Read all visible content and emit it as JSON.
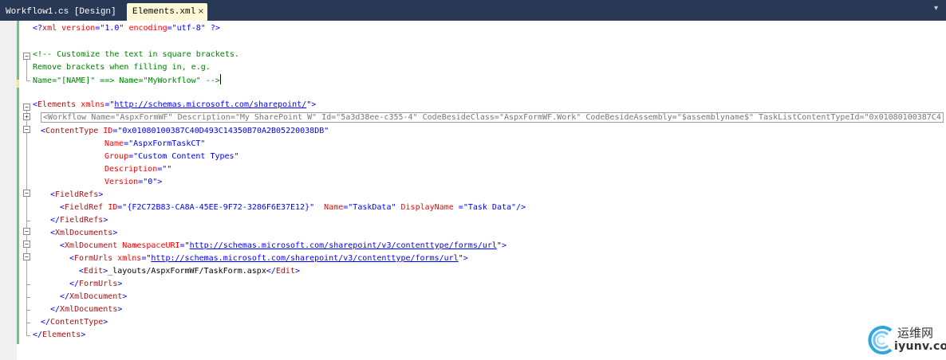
{
  "tabs": {
    "inactive_label": "Workflow1.cs [Design]",
    "active_label": "Elements.xml",
    "close_glyph": "×",
    "dropdown_glyph": "▾"
  },
  "code_lines": [
    [
      "<?",
      "xml",
      " version",
      "=",
      "\"1.0\"",
      " encoding",
      "=",
      "\"utf-8\"",
      " ?>"
    ],
    [],
    [
      "<!-- Customize the text in square brackets."
    ],
    [
      "Remove brackets when filling in, e.g."
    ],
    [
      "Name=\"[NAME]\" ==> Name=\"MyWorkflow\" -->"
    ],
    [],
    [
      "<",
      "Elements",
      " xmlns",
      "=",
      "\"",
      "http://schemas.microsoft.com/sharepoint/",
      "\"",
      ">"
    ],
    [
      "<Workflow Name=\"AspxFormWF\" Description=\"My SharePoint W\" Id=\"5a3d38ee-c355-4\" CodeBesideClass=\"AspxFormWF.Work\" CodeBesideAssembly=\"$assemblyname$\" TaskListContentTypeId=\"0x01080100387C4"
    ],
    [
      "<",
      "ContentType",
      " ID",
      "=",
      "\"0x01080100387C40D493C14350B70A2B05220038DB\""
    ],
    [
      "Name",
      "=",
      "\"AspxFormTaskCT\""
    ],
    [
      "Group",
      "=",
      "\"Custom Content Types\""
    ],
    [
      "Description",
      "=",
      "\"\""
    ],
    [
      "Version",
      "=",
      "\"0\"",
      ">"
    ],
    [
      "<",
      "FieldRefs",
      ">"
    ],
    [
      "<",
      "FieldRef",
      " ID",
      "=",
      "\"{F2C72B83-CA8A-45EE-9F72-3286F6E37E12}\"",
      "  Name",
      "=",
      "\"TaskData\"",
      " DisplayName ",
      "=",
      "\"Task Data\"",
      "/>"
    ],
    [
      "</",
      "FieldRefs",
      ">"
    ],
    [
      "<",
      "XmlDocuments",
      ">"
    ],
    [
      "<",
      "XmlDocument",
      " NamespaceURI",
      "=",
      "\"",
      "http://schemas.microsoft.com/sharepoint/v3/contenttype/forms/url",
      "\"",
      ">"
    ],
    [
      "<",
      "FormUrls",
      " xmlns",
      "=",
      "\"",
      "http://schemas.microsoft.com/sharepoint/v3/contenttype/forms/url",
      "\"",
      ">"
    ],
    [
      "<",
      "Edit",
      ">",
      "_layouts/AspxFormWF/TaskForm.aspx",
      "</",
      "Edit",
      ">"
    ],
    [
      "</",
      "FormUrls",
      ">"
    ],
    [
      "</",
      "XmlDocument",
      ">"
    ],
    [
      "</",
      "XmlDocuments",
      ">"
    ],
    [
      "</",
      "ContentType",
      ">"
    ],
    [
      "</",
      "Elements",
      ">"
    ]
  ],
  "watermark": {
    "cn_text": "运维网",
    "en_text": "iyunv.com"
  },
  "colors": {
    "tab_bar": "#293955",
    "active_tab": "#fff8d8",
    "xml_delimiter": "#0000ff",
    "xml_element": "#a31515",
    "xml_attribute": "#ff0000",
    "xml_value": "#0000ff",
    "comment": "#008000",
    "change_saved": "#6ec67a",
    "change_unsaved": "#f5e97a"
  }
}
